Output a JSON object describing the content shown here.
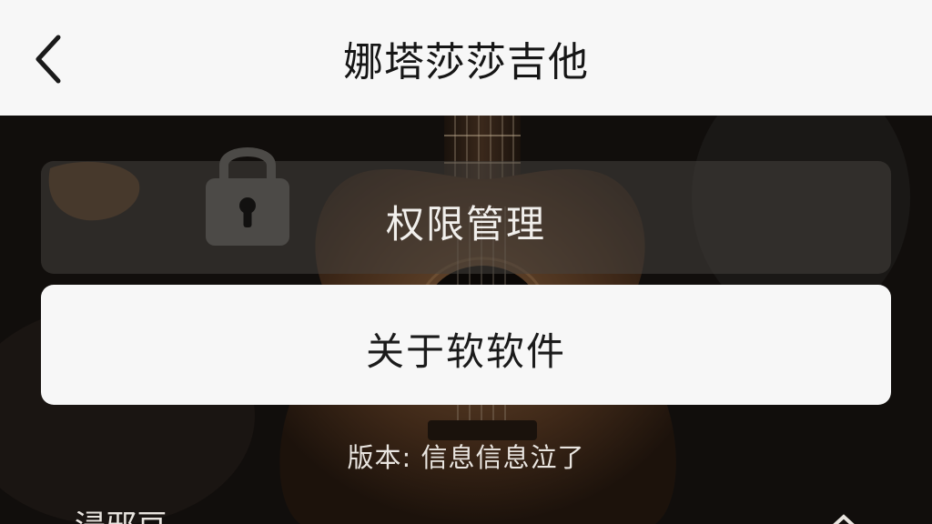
{
  "header": {
    "title": "娜塔莎莎吉他"
  },
  "permissions": {
    "label": "权限管理"
  },
  "about": {
    "label": "关于软软件"
  },
  "version": {
    "text": "版本: 信息信息泣了"
  },
  "bottom_row": {
    "label": "浸邪豆"
  },
  "icons": {
    "back": "chevron-left-icon",
    "lock": "lock-icon",
    "bottom_chevron": "chevron-icon"
  },
  "colors": {
    "header_bg": "#f7f7f7",
    "backdrop": "#100d0b",
    "card_light": "#f7f7f7",
    "card_dark": "#46423e"
  }
}
